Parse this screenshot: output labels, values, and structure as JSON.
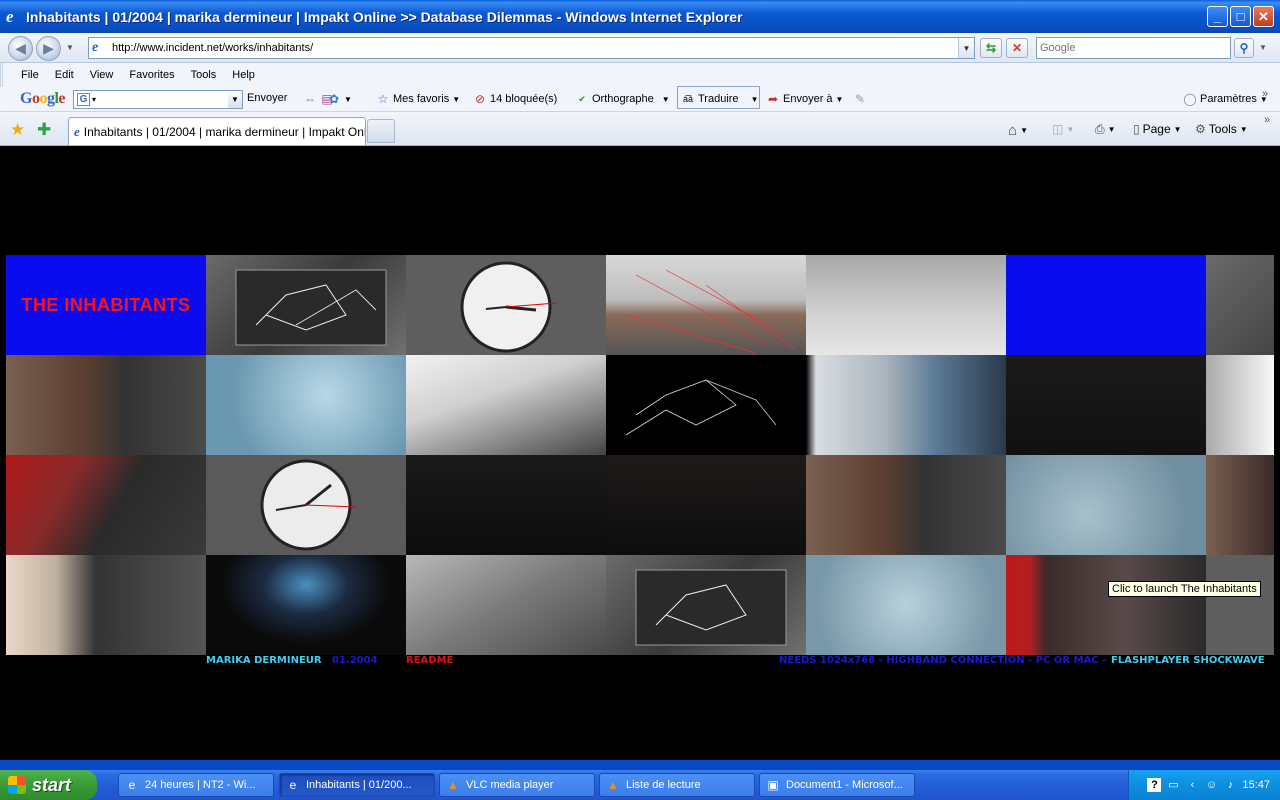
{
  "window": {
    "title": "Inhabitants | 01/2004 | marika dermineur | Impakt Online >> Database Dilemmas - Windows Internet Explorer",
    "buttons": [
      "_",
      "□",
      "✕"
    ]
  },
  "address_bar": {
    "url": "http://www.incident.net/works/inhabitants/",
    "search_placeholder": "Google"
  },
  "menu": [
    "File",
    "Edit",
    "View",
    "Favorites",
    "Tools",
    "Help"
  ],
  "google_toolbar": {
    "logo": "Google",
    "send_label": "Envoyer",
    "favorites_label": "Mes favoris",
    "blocked_label": "14 bloquée(s)",
    "spelling_label": "Orthographe",
    "translate_label": "Traduire",
    "send_to_label": "Envoyer à",
    "settings_label": "Paramètres"
  },
  "tabs": [
    {
      "label": "Inhabitants | 01/2004 | marika dermineur | Impakt Onl..."
    }
  ],
  "command_bar": {
    "page_label": "Page",
    "tools_label": "Tools"
  },
  "content": {
    "title": "THE INHABITANTS",
    "tooltip": "Clic to launch The Inhabitants",
    "footer": {
      "author": "MARIKA DERMINEUR",
      "date": "01.2004",
      "readme": "README",
      "requirements": "NEEDS 1024x768 - HIGHBAND CONNECTION - PC OR MAC -",
      "player": "FLASHPLAYER SHOCKWAVE"
    },
    "tiles": [
      {
        "subject": "title"
      },
      {
        "subject": "led display"
      },
      {
        "subject": "wall clock"
      },
      {
        "subject": "street view"
      },
      {
        "subject": "mopping floor"
      },
      {
        "subject": "blue tile"
      },
      {
        "subject": "led display"
      },
      {
        "subject": "living room"
      },
      {
        "subject": "broken plate"
      },
      {
        "subject": "hand"
      },
      {
        "subject": "network graph"
      },
      {
        "subject": "room"
      },
      {
        "subject": "dark display"
      },
      {
        "subject": "foot"
      },
      {
        "subject": "keyboard typing"
      },
      {
        "subject": "wall clock"
      },
      {
        "subject": "dark figures"
      },
      {
        "subject": "dark scene"
      },
      {
        "subject": "living room"
      },
      {
        "subject": "vacuuming"
      },
      {
        "subject": "living room"
      },
      {
        "subject": "old man portrait"
      },
      {
        "subject": "tv screen"
      },
      {
        "subject": "bed sheets"
      },
      {
        "subject": "led display"
      },
      {
        "subject": "broken glass"
      },
      {
        "subject": "people in room"
      },
      {
        "subject": "wall clock"
      }
    ]
  },
  "taskbar": {
    "start_label": "start",
    "tasks": [
      {
        "label": "24 heures | NT2 - Wi..."
      },
      {
        "label": "Inhabitants | 01/200..."
      },
      {
        "label": "VLC media player"
      },
      {
        "label": "Liste de lecture"
      },
      {
        "label": "Document1 - Microsof..."
      }
    ],
    "clock": "15:47"
  }
}
